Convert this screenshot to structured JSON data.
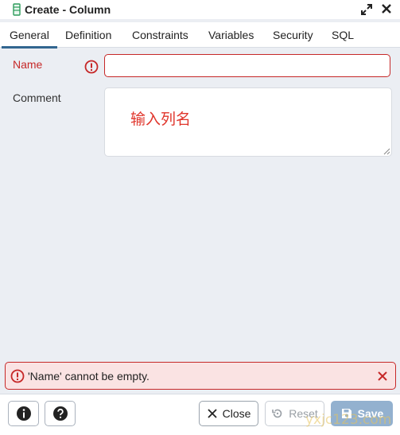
{
  "window": {
    "title": "Create - Column"
  },
  "tabs": [
    {
      "label": "General",
      "active": true
    },
    {
      "label": "Definition"
    },
    {
      "label": "Constraints"
    },
    {
      "label": "Variables"
    },
    {
      "label": "Security"
    },
    {
      "label": "SQL"
    }
  ],
  "form": {
    "name_label": "Name",
    "name_value": "",
    "comment_label": "Comment",
    "comment_value": ""
  },
  "annotation": "输入列名",
  "error": {
    "message": "'Name' cannot be empty."
  },
  "footer": {
    "close_label": "Close",
    "reset_label": "Reset",
    "save_label": "Save"
  },
  "watermark": "yxjc123.com",
  "colors": {
    "error": "#c62828",
    "accent": "#326690",
    "save_disabled": "#93b1cf",
    "annotation": "#e0352b"
  }
}
